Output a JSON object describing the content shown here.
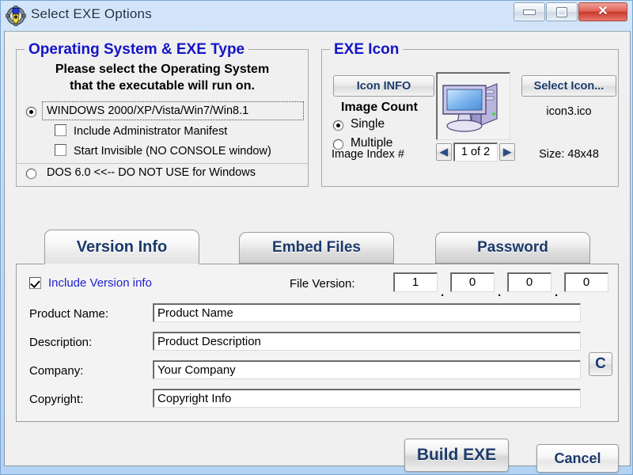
{
  "window": {
    "title": "Select EXE Options",
    "icon": "app-gear-icon",
    "controls": {
      "minimize": "minimize-icon",
      "maximize": "maximize-icon",
      "close": "✕"
    }
  },
  "os_group": {
    "title": "Operating System & EXE Type",
    "instruction_line1": "Please select the Operating System",
    "instruction_line2": "that the executable will run on.",
    "options": [
      {
        "label": "WINDOWS   2000/XP/Vista/Win7/Win8.1",
        "selected": true
      },
      {
        "label": "DOS 6.0 <<-- DO NOT USE for Windows",
        "selected": false
      }
    ],
    "checkboxes": [
      {
        "label": "Include Administrator Manifest",
        "checked": false
      },
      {
        "label": "Start Invisible   (NO CONSOLE window)",
        "checked": false
      }
    ]
  },
  "icon_group": {
    "title": "EXE Icon",
    "icon_info_button": "Icon INFO",
    "select_icon_button": "Select Icon...",
    "image_count_label": "Image Count",
    "count_options": [
      {
        "label": "Single",
        "selected": true
      },
      {
        "label": "Multiple",
        "selected": false
      }
    ],
    "image_index_label": "Image Index #",
    "image_index_value": "1 of 2",
    "prev_glyph": "◀",
    "next_glyph": "▶",
    "icon_file_name": "icon3.ico",
    "icon_size": "Size: 48x48",
    "preview_icon": "my-computer-icon"
  },
  "tabs": [
    {
      "label": "Version Info",
      "active": true
    },
    {
      "label": "Embed Files",
      "active": false
    },
    {
      "label": "Password",
      "active": false
    }
  ],
  "version_panel": {
    "include_version_info": {
      "label": "Include Version info",
      "checked": true
    },
    "file_version_label": "File Version:",
    "file_version_parts": [
      "1",
      "0",
      "0",
      "0"
    ],
    "version_separator": ".",
    "fields": [
      {
        "label": "Product Name:",
        "value": "Product Name"
      },
      {
        "label": "Description:",
        "value": "Product Description"
      },
      {
        "label": "Company:",
        "value": "Your Company"
      },
      {
        "label": "Copyright:",
        "value": "Copyright Info"
      }
    ],
    "copyright_symbol_button": "C"
  },
  "footer": {
    "build_button": "Build EXE",
    "cancel_button": "Cancel"
  },
  "colors": {
    "titlebar": "#bdd9f7",
    "client_bg": "#f0f0f0",
    "group_title": "#1414c8",
    "link_blue": "#2222cc",
    "button_text": "#1b3a6b",
    "close_red": "#c93a2c"
  }
}
